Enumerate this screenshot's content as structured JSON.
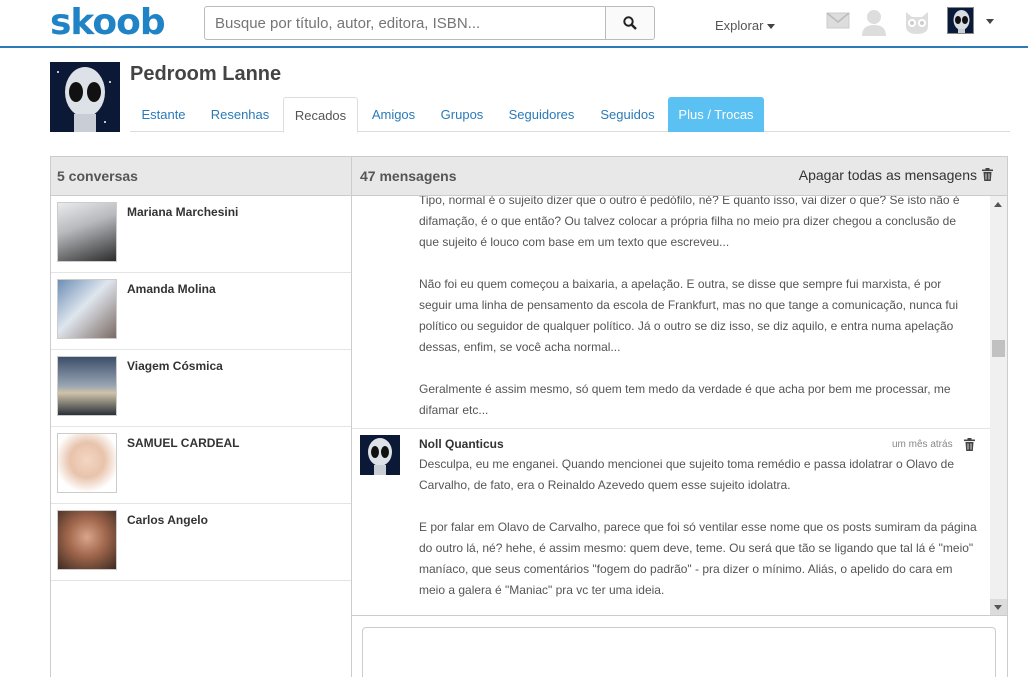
{
  "header": {
    "logo": "skoob",
    "search_placeholder": "Busque por título, autor, editora, ISBN...",
    "explore_label": "Explorar"
  },
  "profile": {
    "name": "Pedroom Lanne"
  },
  "tabs": [
    {
      "label": "Estante"
    },
    {
      "label": "Resenhas"
    },
    {
      "label": "Recados"
    },
    {
      "label": "Amigos"
    },
    {
      "label": "Grupos"
    },
    {
      "label": "Seguidores"
    },
    {
      "label": "Seguidos"
    },
    {
      "label": "Plus / Trocas"
    }
  ],
  "conversations": {
    "header": "5 conversas",
    "items": [
      {
        "name": "Mariana Marchesini"
      },
      {
        "name": "Amanda Molina"
      },
      {
        "name": "Viagem Cósmica"
      },
      {
        "name": "SAMUEL CARDEAL"
      },
      {
        "name": "Carlos Angelo"
      }
    ]
  },
  "messages": {
    "header": "47 mensagens",
    "clear_all": "Apagar todas as mensagens",
    "first_block": [
      "Tipo, normal é o sujeito dizer que o outro é pedófilo, né? E quanto isso, vai dizer o que? Se isto não é difamação, é o que então? Ou talvez colocar a própria filha no meio pra dizer chegou a conclusão de que sujeito é louco com base em um texto que escreveu...",
      "Não foi eu quem começou a baixaria, a apelação. E outra, se disse que sempre fui marxista, é por seguir uma linha de pensamento da escola de Frankfurt, mas no que tange a comunicação, nunca fui político ou seguidor de qualquer político. Já o outro se diz isso, se diz aquilo, e entra numa apelação dessas, enfim, se você acha normal...",
      "Geralmente é assim mesmo, só quem tem medo da verdade é que acha por bem me processar, me difamar etc..."
    ],
    "second": {
      "author": "Noll Quanticus",
      "time": "um mês atrás",
      "paragraphs": [
        "Desculpa, eu me enganei. Quando mencionei que sujeito toma remédio e passa idolatrar o Olavo de Carvalho, de fato, era o Reinaldo Azevedo quem esse sujeito idolatra.",
        "E por falar em Olavo de Carvalho, parece que foi só ventilar esse nome que os posts sumiram da página do outro lá, né? hehe, é assim mesmo: quem deve, teme. Ou será que tão se ligando que tal lá é \"meio\" maníaco, que seus comentários \"fogem do padrão\" - pra dizer o mínimo. Aliás, o apelido do cara em meio a galera é \"Maniac\" pra vc ter uma ideia."
      ]
    }
  },
  "colors": {
    "brand": "#1f83c5",
    "accent_tab": "#5bc0f2",
    "link": "#2a7ab8"
  }
}
